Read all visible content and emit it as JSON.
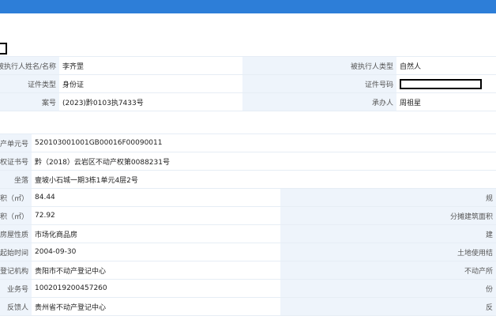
{
  "section1": {
    "rows": [
      {
        "label": "被执行人姓名/名称",
        "value": "李齐罡",
        "label2": "被执行人类型",
        "value2": "自然人"
      },
      {
        "label": "证件类型",
        "value": "身份证",
        "label2": "证件号码",
        "value2": ""
      },
      {
        "label": "案号",
        "value": "(2023)黔0103执7433号",
        "label2": "承办人",
        "value2": "周祖星"
      }
    ]
  },
  "section2": {
    "full_rows": [
      {
        "label": "产单元号",
        "value": "520103001001GB00016F00090011"
      },
      {
        "label": "权证书号",
        "value": "黔（2018）云岩区不动产权第0088231号"
      },
      {
        "label": "坐落",
        "value": "壹坡小石城一期3栋1单元4层2号"
      }
    ],
    "split_rows": [
      {
        "label": "积（㎡）",
        "value": "84.44",
        "label2": "规"
      },
      {
        "label": "积（㎡）",
        "value": "72.92",
        "label2": "分摊建筑面积"
      },
      {
        "label": "房屋性质",
        "value": "市场化商品房",
        "label2": "建"
      },
      {
        "label": "起始时间",
        "value": "2004-09-30",
        "label2": "土地使用结"
      },
      {
        "label": "登记机构",
        "value": "贵阳市不动产登记中心",
        "label2": "不动产所"
      },
      {
        "label": "业务号",
        "value": "1002019200457260",
        "label2": "份"
      },
      {
        "label": "反馈人",
        "value": "贵州省不动产登记中心",
        "label2": "反"
      }
    ]
  }
}
